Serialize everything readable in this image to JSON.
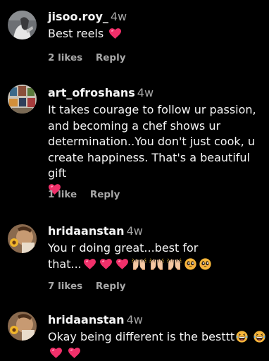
{
  "comments": [
    {
      "username": "jisoo.roy_",
      "time": "4w",
      "text": "Best reels",
      "emoji": [
        "red-heart"
      ],
      "likes": "2 likes",
      "reply": "Reply"
    },
    {
      "username": "art_ofroshans",
      "time": "4w",
      "text_lines": [
        "It takes courage to follow ur passion,",
        "and becoming a chef shows ur",
        "determination..You don't just cook, u",
        "create happiness. That's a beautiful gift"
      ],
      "emoji": [
        "red-heart"
      ],
      "likes": "1 like",
      "reply": "Reply"
    },
    {
      "username": "hridaanstan",
      "time": "4w",
      "text_lines": [
        "You r doing great...best for",
        "that..."
      ],
      "emoji": [
        "red-heart",
        "red-heart",
        "red-heart",
        "raised-hands",
        "raised-hands",
        "raised-hands",
        "pleading-face",
        "pleading-face"
      ],
      "likes": "7 likes",
      "reply": "Reply"
    },
    {
      "username": "hridaanstan",
      "time": "4w",
      "text": "Okay being different is the besttt",
      "emoji": [
        "laughing-face",
        "laughing-face",
        "red-heart",
        "red-heart"
      ],
      "likes": "",
      "reply": ""
    }
  ],
  "colors": {
    "background": "#000000",
    "text": "#f5f5f5",
    "muted": "#a8a8a8",
    "heart": "#f0306a"
  }
}
